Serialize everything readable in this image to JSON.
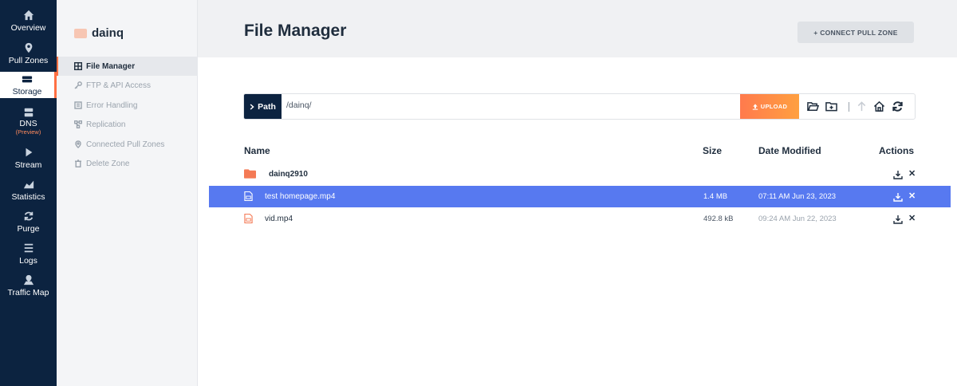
{
  "nav": {
    "items": [
      {
        "label": "Overview",
        "icon": "home-icon"
      },
      {
        "label": "Pull Zones",
        "icon": "location-pin-icon"
      },
      {
        "label": "Storage",
        "icon": "storage-drive-icon",
        "active": true
      },
      {
        "label": "DNS",
        "sub": "(Preview)",
        "icon": "server-icon"
      },
      {
        "label": "Stream",
        "icon": "play-icon"
      },
      {
        "label": "Statistics",
        "icon": "chart-icon"
      },
      {
        "label": "Purge",
        "icon": "refresh-icon"
      },
      {
        "label": "Logs",
        "icon": "list-icon"
      },
      {
        "label": "Traffic Map",
        "icon": "map-pin-icon"
      }
    ]
  },
  "zone": {
    "name": "dainq",
    "menu": [
      {
        "label": "File Manager",
        "icon": "grid-icon",
        "active": true
      },
      {
        "label": "FTP & API Access",
        "icon": "key-icon"
      },
      {
        "label": "Error Handling",
        "icon": "document-icon"
      },
      {
        "label": "Replication",
        "icon": "network-icon"
      },
      {
        "label": "Connected Pull Zones",
        "icon": "location-pin-icon"
      },
      {
        "label": "Delete Zone",
        "icon": "trash-icon"
      }
    ]
  },
  "header": {
    "title": "File Manager",
    "connect_label": "+ CONNECT PULL ZONE"
  },
  "pathbar": {
    "label": "Path",
    "value": "/dainq/",
    "upload_label": "UPLOAD"
  },
  "table": {
    "columns": {
      "name": "Name",
      "size": "Size",
      "date": "Date Modified",
      "actions": "Actions"
    },
    "rows": [
      {
        "type": "folder",
        "name": "dainq2910",
        "size": "",
        "date": ""
      },
      {
        "type": "file",
        "name": "test homepage.mp4",
        "size": "1.4 MB",
        "date": "07:11 AM Jun 23, 2023",
        "selected": true
      },
      {
        "type": "file",
        "name": "vid.mp4",
        "size": "492.8 kB",
        "date": "09:24 AM Jun 22, 2023"
      }
    ]
  },
  "colors": {
    "nav_bg": "#0c2340",
    "accent": "#ff7043",
    "selected_row": "#5779f0",
    "folder": "#f47a55"
  }
}
